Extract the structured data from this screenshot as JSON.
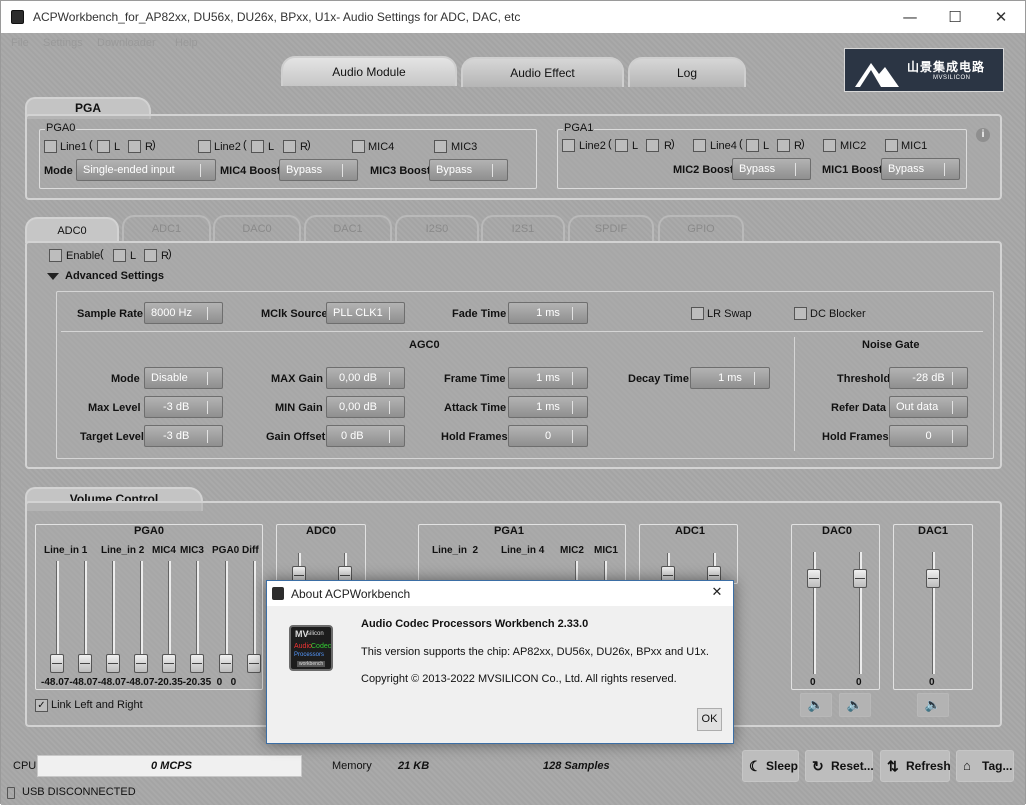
{
  "window": {
    "title": "ACPWorkbench_for_AP82xx, DU56x, DU26x, BPxx, U1x- Audio Settings for ADC, DAC, etc",
    "minimize": "—",
    "maximize": "☐",
    "close": "✕"
  },
  "menu": [
    "File",
    "Settings",
    "Downloader",
    "Help"
  ],
  "main_tabs": [
    "Audio Module",
    "Audio Effect",
    "Log"
  ],
  "logo": {
    "chinese": "山景集成电路",
    "english": "MVSILICON"
  },
  "pga": {
    "tab": "PGA",
    "pga0": {
      "title": "PGA0",
      "line1": "Line1",
      "l": "L",
      "r": "R",
      "line2": "Line2",
      "mic4": "MIC4",
      "mic3": "MIC3",
      "mode_label": "Mode",
      "mode_value": "Single-ended input",
      "mic4_boost_label": "MIC4 Boost",
      "mic4_boost_value": "Bypass",
      "mic3_boost_label": "MIC3 Boost",
      "mic3_boost_value": "Bypass"
    },
    "pga1": {
      "title": "PGA1",
      "line2": "Line2",
      "line4": "Line4",
      "l": "L",
      "r": "R",
      "mic2": "MIC2",
      "mic1": "MIC1",
      "mic2_boost_label": "MIC2 Boost",
      "mic2_boost_value": "Bypass",
      "mic1_boost_label": "MIC1 Boost",
      "mic1_boost_value": "Bypass"
    },
    "info_icon": "i"
  },
  "io_tabs": [
    "ADC0",
    "ADC1",
    "DAC0",
    "DAC1",
    "I2S0",
    "I2S1",
    "SPDIF",
    "GPIO"
  ],
  "adc0": {
    "enable": "Enable",
    "l": "L",
    "r": "R",
    "advanced": "Advanced Settings",
    "sample_rate_label": "Sample Rate",
    "sample_rate_value": "8000 Hz",
    "mclk_label": "MClk Source",
    "mclk_value": "PLL CLK1",
    "fade_label": "Fade Time",
    "fade_value": "1 ms",
    "lr_swap": "LR Swap",
    "dc_blocker": "DC Blocker",
    "agc_title": "AGC0",
    "noise_title": "Noise Gate",
    "mode_label": "Mode",
    "mode_value": "Disable",
    "max_level_label": "Max Level",
    "max_level_value": "-3 dB",
    "target_label": "Target Level",
    "target_value": "-3 dB",
    "max_gain_label": "MAX Gain",
    "max_gain_value": "0,00 dB",
    "min_gain_label": "MIN Gain",
    "min_gain_value": "0,00 dB",
    "gain_offset_label": "Gain Offset",
    "gain_offset_value": "0 dB",
    "frame_label": "Frame Time",
    "frame_value": "1 ms",
    "attack_label": "Attack Time",
    "attack_value": "1 ms",
    "hold_label": "Hold Frames",
    "hold_value": "0",
    "decay_label": "Decay Time",
    "decay_value": "1 ms",
    "threshold_label": "Threshold",
    "threshold_value": "-28 dB",
    "refer_label": "Refer Data",
    "refer_value": "Out data",
    "ng_hold_label": "Hold Frames",
    "ng_hold_value": "0"
  },
  "volume": {
    "tab": "Volume Control",
    "pga0": {
      "title": "PGA0",
      "cols": [
        "Line_in 1",
        "Line_in 2",
        "MIC4",
        "MIC3",
        "PGA0 Diff"
      ],
      "values": "-48.07-48.07-48.07-48.07-20.35-20.35  0   0"
    },
    "adc0": {
      "title": "ADC0"
    },
    "pga1": {
      "title": "PGA1",
      "cols": [
        "Line_in  2",
        "Line_in 4",
        "MIC2",
        "MIC1"
      ]
    },
    "adc1": {
      "title": "ADC1"
    },
    "dac0": {
      "title": "DAC0",
      "values": [
        "0",
        "0"
      ]
    },
    "dac1": {
      "title": "DAC1",
      "values": [
        "0"
      ]
    },
    "link": "Link Left and Right"
  },
  "status": {
    "cpu_label": "CPU",
    "cpu_value": "0 MCPS",
    "memory_label": "Memory",
    "memory_value": "21 KB",
    "samples": "128 Samples",
    "usb": "USB DISCONNECTED"
  },
  "buttons": {
    "sleep": "Sleep",
    "reset": "Reset...",
    "refresh": "Refresh",
    "tag": "Tag..."
  },
  "about": {
    "title": "About ACPWorkbench",
    "close": "✕",
    "product": "Audio Codec Processors Workbench 2.33.0",
    "chips": "This version supports the chip: AP82xx, DU56x, DU26x, BPxx and U1x.",
    "copyright": "Copyright © 2013-2022 MVSILICON Co., Ltd. All rights reserved.",
    "ok": "OK",
    "icon_text": {
      "mv": "MV",
      "silicon": "silicon",
      "audio": "Audio",
      "codec": "Codec",
      "processors": "Processors",
      "workbench": "workbench"
    }
  }
}
